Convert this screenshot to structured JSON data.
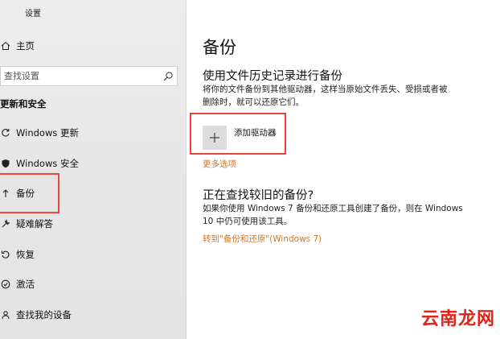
{
  "app": {
    "title": "设置"
  },
  "sidebar": {
    "home": {
      "label": "主页",
      "icon": "home-icon"
    },
    "search": {
      "placeholder": "查找设置",
      "icon": "search-icon"
    },
    "section_title": "更新和安全",
    "items": [
      {
        "label": "Windows 更新",
        "icon": "sync-icon"
      },
      {
        "label": "Windows 安全",
        "icon": "shield-icon"
      },
      {
        "label": "备份",
        "icon": "backup-arrow-icon",
        "selected": true
      },
      {
        "label": "疑难解答",
        "icon": "wrench-icon"
      },
      {
        "label": "恢复",
        "icon": "recovery-icon"
      },
      {
        "label": "激活",
        "icon": "check-circle-icon"
      },
      {
        "label": "查找我的设备",
        "icon": "person-pin-icon"
      }
    ]
  },
  "main": {
    "title": "备份",
    "file_history": {
      "heading": "使用文件历史记录进行备份",
      "description_line1": "将你的文件备份到其他驱动器，这样当原始文件丢失、受损或者被",
      "description_line2": "删除时，就可以还原它们。",
      "add_drive_label": "添加驱动器",
      "add_icon": "plus-icon",
      "more_options": "更多选项"
    },
    "older_backup": {
      "heading": "正在查找较旧的备份?",
      "description_line1": "如果你使用 Windows 7 备份和还原工具创建了备份，则在 Windows",
      "description_line2": "10 中仍可使用该工具。",
      "link": "转到\"备份和还原\"(Windows 7)"
    }
  },
  "watermark": "云南龙网",
  "colors": {
    "accent_link": "#d0782a",
    "highlight_box": "#e8443a",
    "sidebar_bg": "#e8e8e8"
  }
}
